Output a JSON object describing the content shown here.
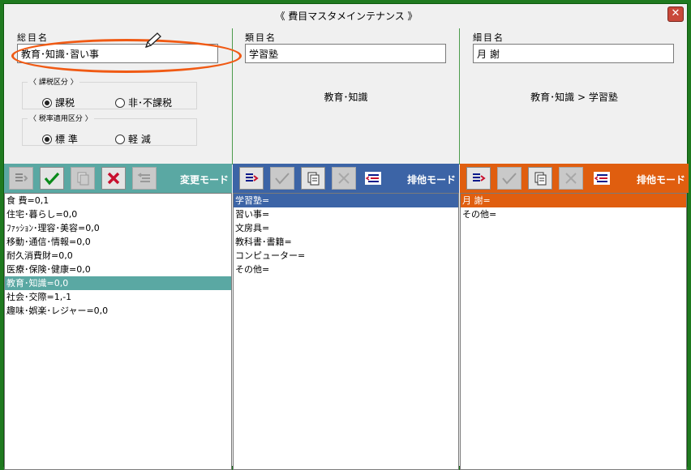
{
  "window": {
    "title": "《 費目マスタメインテナンス 》",
    "close_glyph": "✕"
  },
  "columns": {
    "major": {
      "label": "総目名",
      "value": "教育･知識･習い事"
    },
    "category": {
      "label": "類目名",
      "value": "学習塾",
      "breadcrumb": "教育･知識"
    },
    "detail": {
      "label": "細目名",
      "value": "月 謝",
      "breadcrumb": "教育･知識 > 学習塾"
    }
  },
  "tax_group": {
    "legend": "〈 課税区分 〉",
    "options": [
      "課税",
      "非･不課税"
    ],
    "selected": 0
  },
  "rate_group": {
    "legend": "〈 税率適用区分 〉",
    "options": [
      "標 準",
      "軽 減"
    ],
    "selected": 0
  },
  "toolbars": {
    "major": {
      "mode": "変更モード",
      "icons": [
        "insert-icon",
        "check-icon",
        "copy-icon",
        "delete-icon",
        "move-icon"
      ]
    },
    "category": {
      "mode": "排他モード",
      "icons": [
        "insert-icon",
        "check-icon",
        "copy-icon",
        "delete-icon",
        "move-icon"
      ]
    },
    "detail": {
      "mode": "排他モード",
      "icons": [
        "insert-icon",
        "check-icon",
        "copy-icon",
        "delete-icon",
        "move-icon"
      ]
    }
  },
  "lists": {
    "major": {
      "items": [
        "食 費=0,1",
        "住宅･暮らし=0,0",
        "ﾌｧｯｼｮﾝ･理容･美容=0,0",
        "移動･通信･情報=0,0",
        "耐久消費財=0,0",
        "医療･保険･健康=0,0",
        "教育･知識=0,0",
        "社会･交際=1,-1",
        "趣味･娯楽･レジャー=0,0"
      ],
      "selected": 6
    },
    "category": {
      "items": [
        "学習塾=",
        "習い事=",
        "文房具=",
        "教科書･書籍=",
        "コンピューター=",
        "その他="
      ],
      "selected": 0
    },
    "detail": {
      "items": [
        "月 謝=",
        "その他="
      ],
      "selected": 0
    }
  },
  "colors": {
    "frame": "#1f7a1f",
    "teal": "#5aa8a3",
    "blue": "#3c64a6",
    "orange": "#e05e0f",
    "annotation": "#f05a14"
  }
}
